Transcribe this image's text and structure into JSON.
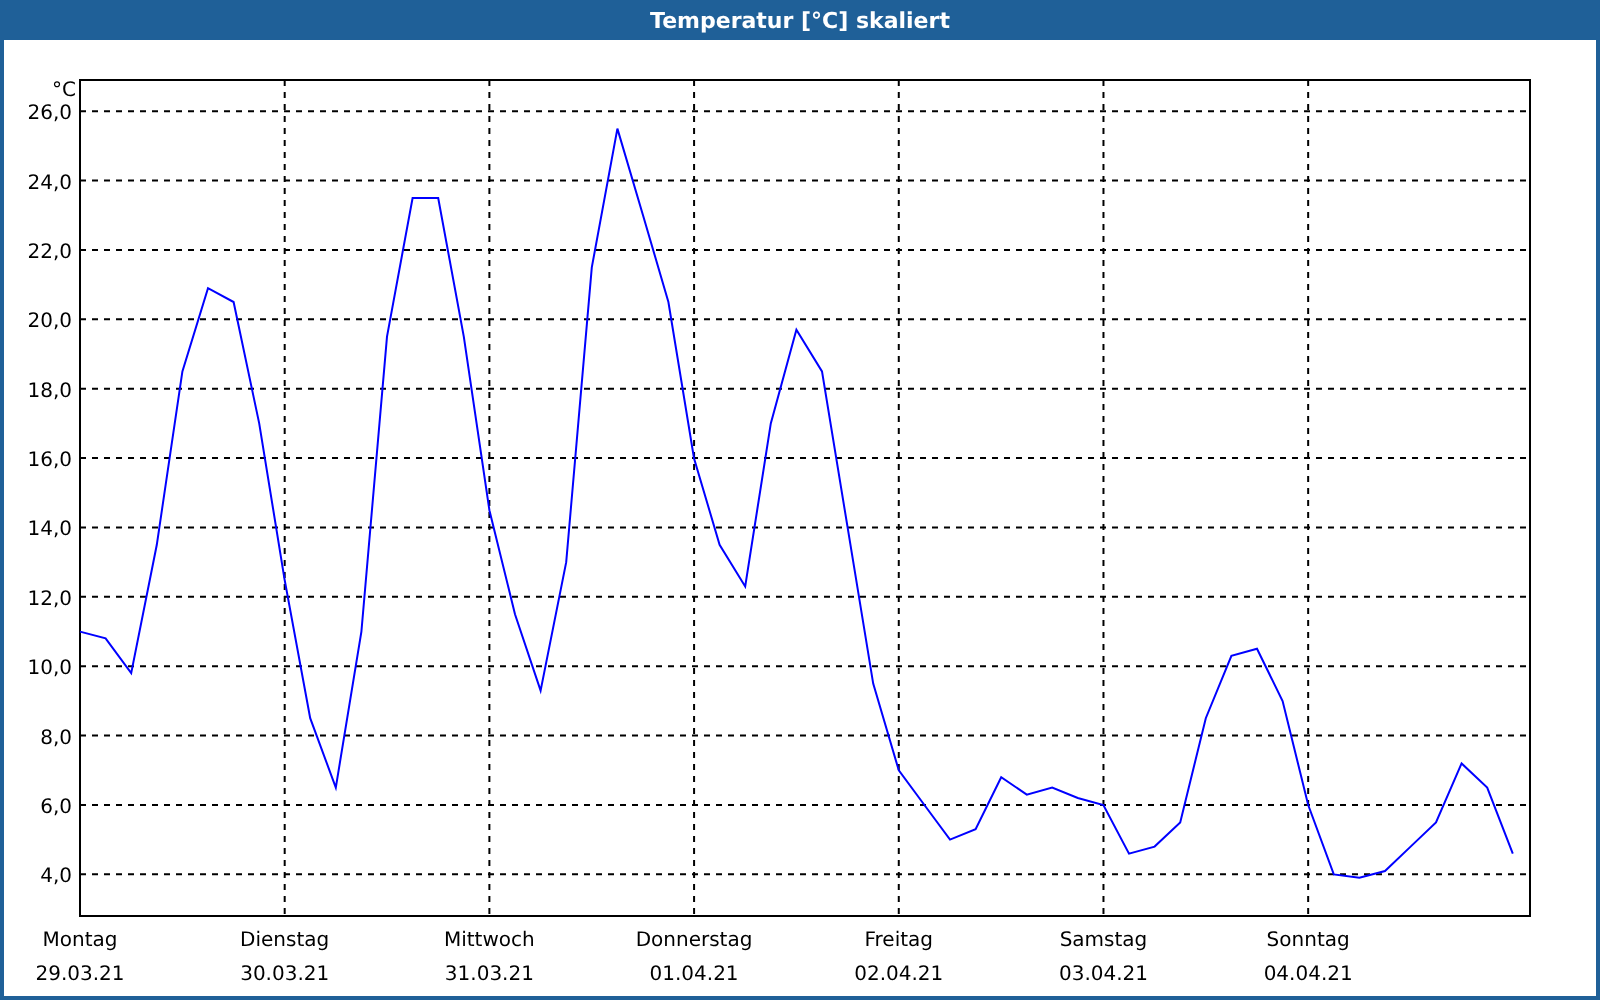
{
  "window": {
    "title": "Temperatur [°C] skaliert"
  },
  "chart": {
    "chart_data": {
      "type": "line",
      "grid": true,
      "ylabel": "°C",
      "ylim": [
        2.8,
        26.9
      ],
      "yticks": [
        {
          "value": 4,
          "label": "4,0"
        },
        {
          "value": 6,
          "label": "6,0"
        },
        {
          "value": 8,
          "label": "8,0"
        },
        {
          "value": 10,
          "label": "10,0"
        },
        {
          "value": 12,
          "label": "12,0"
        },
        {
          "value": 14,
          "label": "14,0"
        },
        {
          "value": 16,
          "label": "16,0"
        },
        {
          "value": 18,
          "label": "18,0"
        },
        {
          "value": 20,
          "label": "20,0"
        },
        {
          "value": 22,
          "label": "22,0"
        },
        {
          "value": 24,
          "label": "24,0"
        },
        {
          "value": 26,
          "label": "26,0"
        }
      ],
      "categories": [
        "Montag 29.03.21",
        null,
        null,
        null,
        null,
        null,
        null,
        null,
        "Dienstag 30.03.21",
        null,
        null,
        null,
        null,
        null,
        null,
        null,
        "Mittwoch 31.03.21",
        null,
        null,
        null,
        null,
        null,
        null,
        null,
        "Donnerstag 01.04.21",
        null,
        null,
        null,
        null,
        null,
        null,
        null,
        "Freitag 02.04.21",
        null,
        null,
        null,
        null,
        null,
        null,
        null,
        "Samstag 03.04.21",
        null,
        null,
        null,
        null,
        null,
        null,
        null,
        "Sonntag 04.04.21",
        null,
        null,
        null,
        null,
        null,
        null,
        null,
        null
      ],
      "series": [
        {
          "color": "#0000ff",
          "values": [
            11.0,
            10.8,
            9.8,
            13.5,
            18.5,
            20.9,
            20.5,
            17.0,
            12.5,
            8.5,
            6.5,
            11.0,
            19.5,
            23.5,
            23.5,
            19.5,
            14.5,
            11.5,
            9.3,
            13.0,
            21.5,
            25.5,
            23.0,
            20.5,
            16.0,
            13.5,
            12.3,
            17.0,
            19.7,
            18.5,
            14.0,
            9.5,
            7.0,
            6.0,
            5.0,
            5.3,
            6.8,
            6.3,
            6.5,
            6.2,
            6.0,
            4.6,
            4.8,
            5.5,
            8.5,
            10.3,
            10.5,
            9.0,
            6.0,
            4.0,
            3.9,
            4.1,
            4.8,
            5.5,
            7.2,
            6.5,
            4.6
          ]
        }
      ]
    }
  }
}
